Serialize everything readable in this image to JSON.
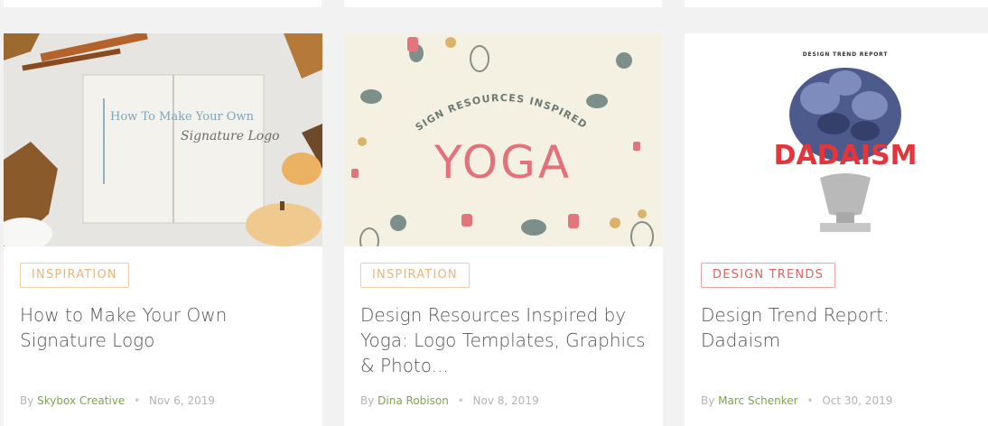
{
  "colors": {
    "page_bg": "#f2f2f2",
    "card_bg": "#ffffff",
    "inspiration": "#e9b57c",
    "design_trends": "#e0625e",
    "author_link": "#7fa447",
    "meta_text": "#b4b4b4"
  },
  "articles": [
    {
      "category": "INSPIRATION",
      "title": "How to Make Your Own Signature Logo",
      "by": "By",
      "author": "Skybox Creative",
      "date": "Nov 6, 2019",
      "image": {
        "left_text": "How To Make Your Own",
        "right_text": "Signature Logo"
      }
    },
    {
      "category": "INSPIRATION",
      "title": "Design Resources Inspired by Yoga: Logo Templates, Graphics & Photo...",
      "by": "By",
      "author": "Dina Robison",
      "date": "Nov 8, 2019",
      "image": {
        "arc_text": "DESIGN RESOURCES INSPIRED BY",
        "big_text": "YOGA"
      }
    },
    {
      "category": "DESIGN TRENDS",
      "title": "Design Trend Report: Dadaism",
      "by": "By",
      "author": "Marc Schenker",
      "date": "Oct 30, 2019",
      "image": {
        "small_text": "DESIGN TREND REPORT",
        "big_text": "DADAISM"
      }
    }
  ]
}
